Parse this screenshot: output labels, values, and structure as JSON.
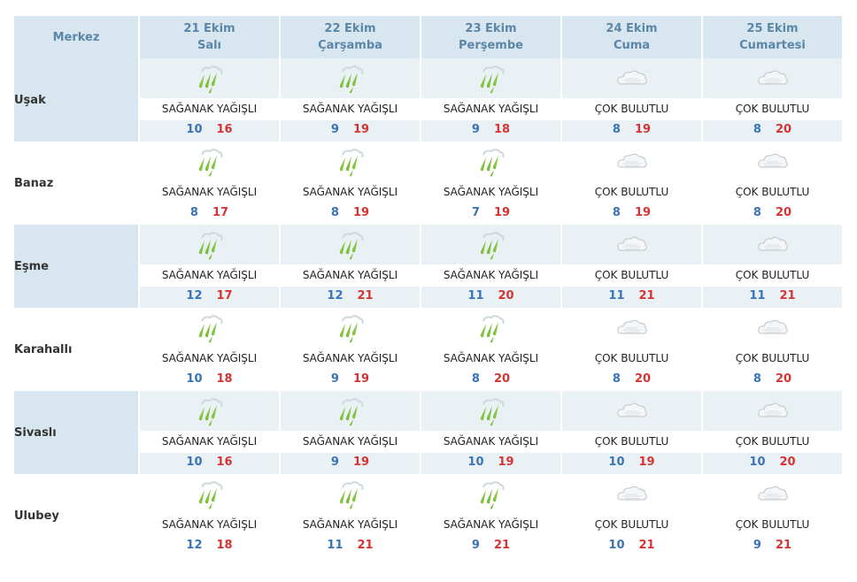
{
  "header": {
    "location_col": "Merkez",
    "days": [
      {
        "date": "21 Ekim",
        "weekday": "Salı"
      },
      {
        "date": "22 Ekim",
        "weekday": "Çarşamba"
      },
      {
        "date": "23 Ekim",
        "weekday": "Perşembe"
      },
      {
        "date": "24 Ekim",
        "weekday": "Cuma"
      },
      {
        "date": "25 Ekim",
        "weekday": "Cumartesi"
      }
    ]
  },
  "colors": {
    "min_temp": "#3a74b6",
    "max_temp": "#d63333",
    "header_bg": "#d8e6ef",
    "header_text": "#5a86a8",
    "rain_icon": "#7fc63a"
  },
  "rows": [
    {
      "city": "Uşak",
      "days": [
        {
          "icon": "shower-rain-icon",
          "desc": "SAĞANAK YAĞIŞLI",
          "min": "10",
          "max": "16"
        },
        {
          "icon": "shower-rain-icon",
          "desc": "SAĞANAK YAĞIŞLI",
          "min": "9",
          "max": "19"
        },
        {
          "icon": "shower-rain-icon",
          "desc": "SAĞANAK YAĞIŞLI",
          "min": "9",
          "max": "18"
        },
        {
          "icon": "cloudy-icon",
          "desc": "ÇOK BULUTLU",
          "min": "8",
          "max": "19"
        },
        {
          "icon": "cloudy-icon",
          "desc": "ÇOK BULUTLU",
          "min": "8",
          "max": "20"
        }
      ]
    },
    {
      "city": "Banaz",
      "days": [
        {
          "icon": "shower-rain-icon",
          "desc": "SAĞANAK YAĞIŞLI",
          "min": "8",
          "max": "17"
        },
        {
          "icon": "shower-rain-icon",
          "desc": "SAĞANAK YAĞIŞLI",
          "min": "8",
          "max": "19"
        },
        {
          "icon": "shower-rain-icon",
          "desc": "SAĞANAK YAĞIŞLI",
          "min": "7",
          "max": "19"
        },
        {
          "icon": "cloudy-icon",
          "desc": "ÇOK BULUTLU",
          "min": "8",
          "max": "19"
        },
        {
          "icon": "cloudy-icon",
          "desc": "ÇOK BULUTLU",
          "min": "8",
          "max": "20"
        }
      ]
    },
    {
      "city": "Eşme",
      "days": [
        {
          "icon": "shower-rain-icon",
          "desc": "SAĞANAK YAĞIŞLI",
          "min": "12",
          "max": "17"
        },
        {
          "icon": "shower-rain-icon",
          "desc": "SAĞANAK YAĞIŞLI",
          "min": "12",
          "max": "21"
        },
        {
          "icon": "shower-rain-icon",
          "desc": "SAĞANAK YAĞIŞLI",
          "min": "11",
          "max": "20"
        },
        {
          "icon": "cloudy-icon",
          "desc": "ÇOK BULUTLU",
          "min": "11",
          "max": "21"
        },
        {
          "icon": "cloudy-icon",
          "desc": "ÇOK BULUTLU",
          "min": "11",
          "max": "21"
        }
      ]
    },
    {
      "city": "Karahallı",
      "days": [
        {
          "icon": "shower-rain-icon",
          "desc": "SAĞANAK YAĞIŞLI",
          "min": "10",
          "max": "18"
        },
        {
          "icon": "shower-rain-icon",
          "desc": "SAĞANAK YAĞIŞLI",
          "min": "9",
          "max": "19"
        },
        {
          "icon": "shower-rain-icon",
          "desc": "SAĞANAK YAĞIŞLI",
          "min": "8",
          "max": "20"
        },
        {
          "icon": "cloudy-icon",
          "desc": "ÇOK BULUTLU",
          "min": "8",
          "max": "20"
        },
        {
          "icon": "cloudy-icon",
          "desc": "ÇOK BULUTLU",
          "min": "8",
          "max": "20"
        }
      ]
    },
    {
      "city": "Sivaslı",
      "days": [
        {
          "icon": "shower-rain-icon",
          "desc": "SAĞANAK YAĞIŞLI",
          "min": "10",
          "max": "16"
        },
        {
          "icon": "shower-rain-icon",
          "desc": "SAĞANAK YAĞIŞLI",
          "min": "9",
          "max": "19"
        },
        {
          "icon": "shower-rain-icon",
          "desc": "SAĞANAK YAĞIŞLI",
          "min": "10",
          "max": "19"
        },
        {
          "icon": "cloudy-icon",
          "desc": "ÇOK BULUTLU",
          "min": "10",
          "max": "19"
        },
        {
          "icon": "cloudy-icon",
          "desc": "ÇOK BULUTLU",
          "min": "10",
          "max": "20"
        }
      ]
    },
    {
      "city": "Ulubey",
      "days": [
        {
          "icon": "shower-rain-icon",
          "desc": "SAĞANAK YAĞIŞLI",
          "min": "12",
          "max": "18"
        },
        {
          "icon": "shower-rain-icon",
          "desc": "SAĞANAK YAĞIŞLI",
          "min": "11",
          "max": "21"
        },
        {
          "icon": "shower-rain-icon",
          "desc": "SAĞANAK YAĞIŞLI",
          "min": "9",
          "max": "21"
        },
        {
          "icon": "cloudy-icon",
          "desc": "ÇOK BULUTLU",
          "min": "10",
          "max": "21"
        },
        {
          "icon": "cloudy-icon",
          "desc": "ÇOK BULUTLU",
          "min": "9",
          "max": "21"
        }
      ]
    }
  ]
}
